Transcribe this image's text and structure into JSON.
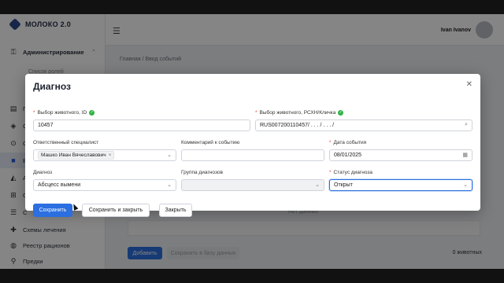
{
  "app": {
    "brand": "МОЛОКО 2.0",
    "user_name": "Ivan Ivanov"
  },
  "sidebar": {
    "items": [
      {
        "label": "Администрирование",
        "icon": "key-icon"
      },
      {
        "label": "Список ролей",
        "icon": ""
      },
      {
        "label": "П",
        "icon": "clipboard-icon"
      },
      {
        "label": "С",
        "icon": "layers-icon"
      },
      {
        "label": "С",
        "icon": "cart-icon"
      },
      {
        "label": "Вв",
        "icon": "book-icon"
      },
      {
        "label": "А",
        "icon": "chart-icon"
      },
      {
        "label": "О",
        "icon": "grid-icon"
      },
      {
        "label": "С",
        "icon": "list-icon"
      },
      {
        "label": "Реестр рационов",
        "icon": "cow-icon"
      },
      {
        "label": "Схемы лечения",
        "icon": "medkit-icon"
      },
      {
        "label": "Реестр рационов",
        "icon": "dish-icon"
      },
      {
        "label": "Предки",
        "icon": "tree-icon"
      }
    ]
  },
  "page": {
    "breadcrumb": "Главная  /  Ввод событий",
    "empty_text": "Нет данных",
    "add_label": "Добавить",
    "save_herd_label": "Сохранить в базу данных",
    "animals_count": "0 животных"
  },
  "modal": {
    "title": "Диагноз",
    "fields": {
      "animal_id_label": "Выбор животного, ID",
      "animal_id_value": "10457",
      "animal_rskh_label": "Выбор животного, РСХН/Кличка",
      "animal_rskh_value": "RUS007200110457/ . . . / . . . /",
      "specialist_label": "Ответственный специалист",
      "specialist_tag": "Машко Иван Вячеславович",
      "comment_label": "Комментарий к событию",
      "comment_value": "",
      "date_label": "Дата события",
      "date_value": "08/01/2025",
      "diagnosis_label": "Диагноз",
      "diagnosis_value": "Абсцесс вымени",
      "group_label": "Группа диагнозов",
      "group_value": "",
      "status_label": "Статус диагноза",
      "status_value": "Открыт"
    },
    "buttons": {
      "save": "Сохранить",
      "save_close": "Сохранить и закрыть",
      "close": "Закрыть"
    }
  },
  "colors": {
    "primary": "#2b6fe0",
    "ok": "#2fb344",
    "required": "#e0453a"
  }
}
